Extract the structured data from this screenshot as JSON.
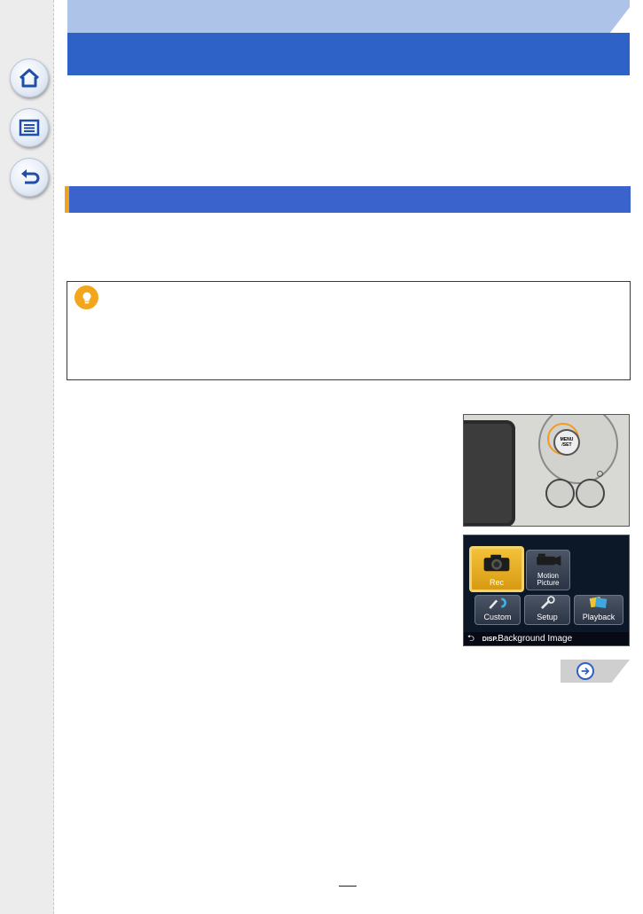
{
  "sidebar": {
    "items": [
      {
        "icon": "home-icon"
      },
      {
        "icon": "contents-list-icon"
      },
      {
        "icon": "back-arrow-icon"
      }
    ]
  },
  "header": {
    "light_band_color": "#aec3e8",
    "dark_band_color": "#2f62c7"
  },
  "section_bar": {
    "color": "#3a64cc",
    "accent_color": "#f0a21b"
  },
  "tip": {
    "icon": "lightbulb-icon"
  },
  "camera_image": {
    "button_text": "MENU\n/SET"
  },
  "menu_image": {
    "tiles": [
      {
        "label": "Rec",
        "selected": true
      },
      {
        "label": "Motion\nPicture",
        "selected": false
      },
      {
        "label": "Custom",
        "selected": false
      },
      {
        "label": "Setup",
        "selected": false
      },
      {
        "label": "Playback",
        "selected": false
      }
    ],
    "footer": {
      "back_symbol": "⮌",
      "disp_label": "DISP.",
      "text": "Background Image"
    }
  },
  "navigation": {
    "next_icon": "arrow-right-icon"
  }
}
